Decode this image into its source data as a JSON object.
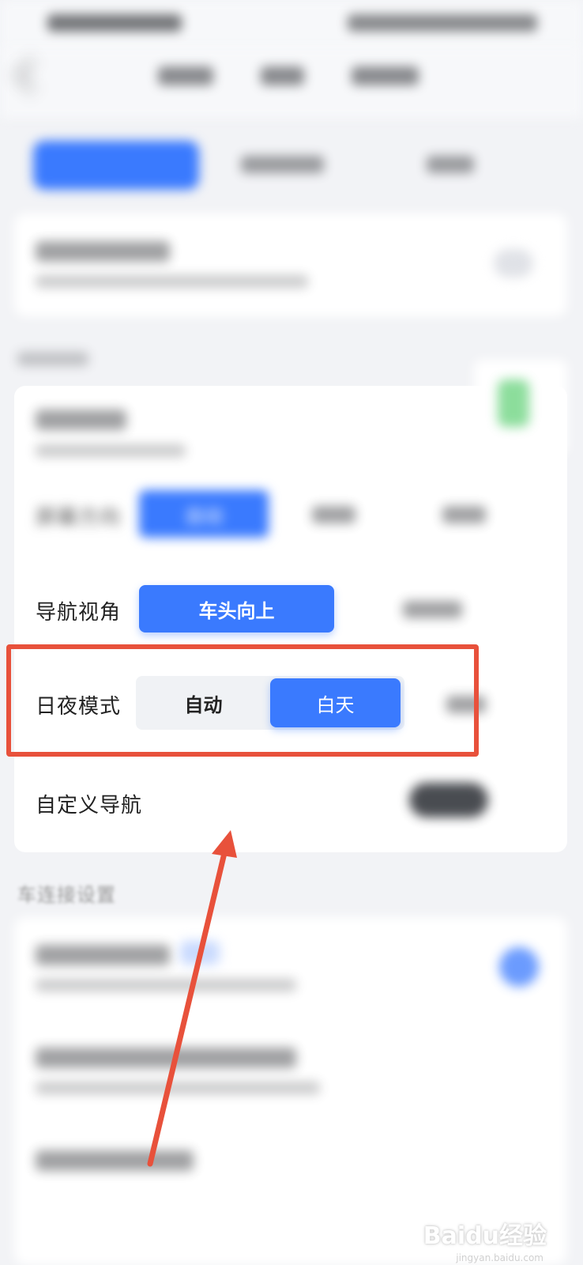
{
  "settings": {
    "screen_direction": {
      "label": "屏幕方向",
      "selected": "自动"
    },
    "nav_view": {
      "label": "导航视角",
      "selected": "车头向上"
    },
    "day_night": {
      "label": "日夜模式",
      "options": [
        "自动",
        "白天"
      ],
      "selected": "白天"
    },
    "custom_nav": {
      "label": "自定义导航"
    }
  },
  "sections": {
    "car_connect": "车连接设置"
  },
  "watermark": {
    "brand": "Baidu经验",
    "url": "jingyan.baidu.com"
  },
  "colors": {
    "accent": "#3a7afe",
    "highlight": "#e8513b"
  }
}
